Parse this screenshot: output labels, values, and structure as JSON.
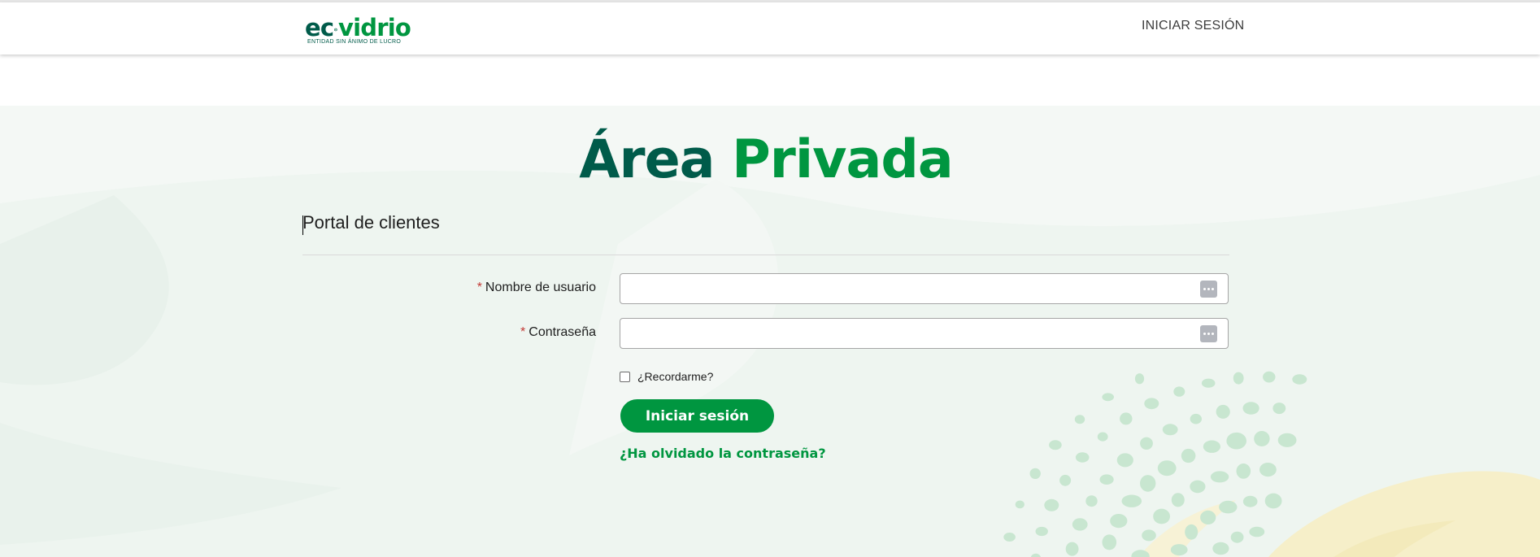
{
  "header": {
    "logo": {
      "word_dark": "ec",
      "word_green": "vidrio",
      "tagline": "ENTIDAD SIN ÁNIMO DE LUCRO",
      "icon": "leaf-o-icon"
    },
    "nav_login": "INICIAR SESIÓN"
  },
  "main": {
    "title_dark": "Área",
    "title_green": "Privada",
    "section_title": "Portal de clientes",
    "form": {
      "required_mark": "*",
      "username_label": "Nombre de usuario",
      "username_value": "",
      "password_label": "Contraseña",
      "password_value": "",
      "field_icon": "password-manager-icon",
      "remember_label": "¿Recordarme?",
      "remember_checked": false,
      "submit_label": "Iniciar sesión",
      "forgot_link": "¿Ha olvidado la contraseña?"
    }
  },
  "colors": {
    "brand_dark": "#005b4a",
    "brand_green": "#009640",
    "required": "#c23934",
    "background_wash": "#eef5f0",
    "decor_dots": "#c8e6d0",
    "decor_yellow": "#f6efc9"
  }
}
